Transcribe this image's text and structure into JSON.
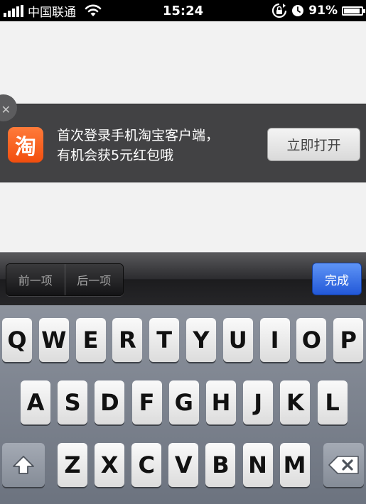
{
  "status_bar": {
    "carrier": "中国联通",
    "time": "15:24",
    "battery_percent": "91%",
    "battery_level": 0.91,
    "icons": [
      "signal-icon",
      "wifi-icon",
      "rotation-lock-icon",
      "alarm-icon",
      "battery-icon"
    ]
  },
  "banner": {
    "close_glyph": "✕",
    "app_icon_glyph": "淘",
    "line1": "首次登录手机淘宝客户端，",
    "line2": "有机会获5元红包哦",
    "open_label": "立即打开"
  },
  "form_toolbar": {
    "prev_label": "前一项",
    "next_label": "后一项",
    "done_label": "完成"
  },
  "keyboard": {
    "row1": [
      "Q",
      "W",
      "E",
      "R",
      "T",
      "Y",
      "U",
      "I",
      "O",
      "P"
    ],
    "row2": [
      "A",
      "S",
      "D",
      "F",
      "G",
      "H",
      "J",
      "K",
      "L"
    ],
    "row3": [
      "Z",
      "X",
      "C",
      "V",
      "B",
      "N",
      "M"
    ]
  },
  "colors": {
    "status_bar_bg": "#000000",
    "banner_bg": "#424244",
    "app_icon": "#f25a16",
    "done_button": "#2f6ae6",
    "keyboard_bg": "#7b818c"
  }
}
